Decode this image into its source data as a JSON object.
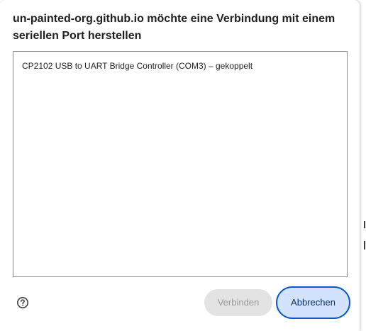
{
  "dialog": {
    "title": "un-painted-org.github.io möchte eine Verbindung mit einem seriellen Port herstellen"
  },
  "device_list": {
    "items": [
      {
        "label": "CP2102 USB to UART Bridge Controller (COM3) – gekoppelt"
      }
    ]
  },
  "footer": {
    "help_icon": "help-circle-icon",
    "connect_label": "Verbinden",
    "cancel_label": "Abbrechen"
  },
  "colors": {
    "accent": "#0b57d0",
    "cancel_bg": "#d3e3fd",
    "disabled_bg": "#e3e3e3",
    "disabled_text": "#9a9a9a"
  }
}
